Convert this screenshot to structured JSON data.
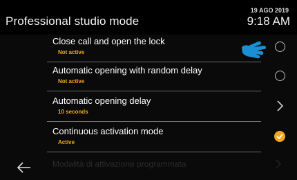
{
  "header": {
    "title": "Professional studio mode",
    "date": "19 AGO 2019",
    "time": "9:18 AM"
  },
  "colors": {
    "accent": "#f2a819",
    "pointer_hand": "#1a8fd6",
    "background": "#0a0a0a"
  },
  "menu": {
    "items": [
      {
        "label": "Close call and open the lock",
        "status": "Not active",
        "control": "radio",
        "selected": false
      },
      {
        "label": "Automatic opening with random delay",
        "status": "Not active",
        "control": "radio",
        "selected": false
      },
      {
        "label": "Automatic opening delay",
        "status": "10 seconds",
        "control": "chevron"
      },
      {
        "label": "Continuous activation mode",
        "status": "Active",
        "control": "check",
        "selected": true
      }
    ],
    "partial_item": {
      "label": "Modalità di attivazione programmata",
      "control": "chevron"
    }
  },
  "icons": {
    "back": "arrow-left-icon",
    "pointer": "pointing-hand-icon"
  }
}
